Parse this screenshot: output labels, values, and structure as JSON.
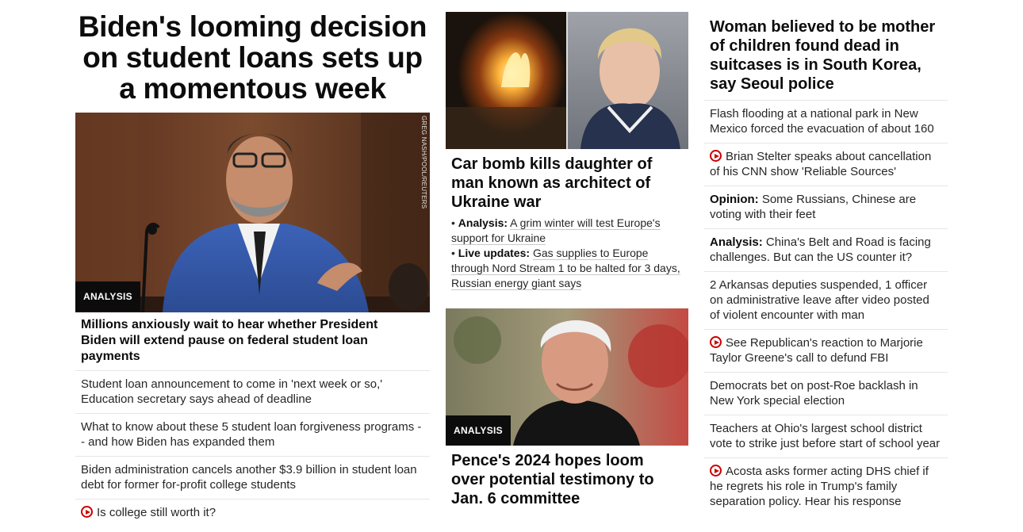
{
  "col1": {
    "headline": "Biden's looming decision on student loans sets up a momentous week",
    "image_badge": "ANALYSIS",
    "image_credit": "GREG NASH/POOL/REUTERS",
    "caption": "Millions anxiously wait to hear whether President Biden will extend pause on federal student loan payments",
    "links": [
      "Student loan announcement to come in 'next week or so,' Education secretary says ahead of deadline",
      "What to know about these 5 student loan forgiveness programs -- and how Biden has expanded them",
      "Biden administration cancels another $3.9 billion in student loan debt for former for-profit college students",
      "Is college still worth it?"
    ]
  },
  "col2": {
    "story1": {
      "headline": "Car bomb kills daughter of man known as architect of Ukraine war",
      "bullet1_label": "Analysis:",
      "bullet1_text": "A grim winter will test Europe's support for Ukraine",
      "bullet2_label": "Live updates:",
      "bullet2_text": "Gas supplies to Europe through Nord Stream 1 to be halted for 3 days, Russian energy giant says"
    },
    "story2": {
      "image_badge": "ANALYSIS",
      "headline": "Pence's 2024 hopes loom over potential testimony to Jan. 6 committee"
    }
  },
  "col3": {
    "lead": "Woman believed to be mother of children found dead in suitcases is in South Korea, say Seoul police",
    "items": [
      {
        "prefix": "",
        "text": "Flash flooding at a national park in New Mexico forced the evacuation of about 160",
        "video": false
      },
      {
        "prefix": "",
        "text": "Brian Stelter speaks about cancellation of his CNN show 'Reliable Sources'",
        "video": true
      },
      {
        "prefix": "Opinion:",
        "text": " Some Russians, Chinese are voting with their feet",
        "video": false
      },
      {
        "prefix": "Analysis:",
        "text": " China's Belt and Road is facing challenges. But can the US counter it?",
        "video": false
      },
      {
        "prefix": "",
        "text": "2 Arkansas deputies suspended, 1 officer on administrative leave after video posted of violent encounter with man",
        "video": false
      },
      {
        "prefix": "",
        "text": "See Republican's reaction to Marjorie Taylor Greene's call to defund FBI",
        "video": true
      },
      {
        "prefix": "",
        "text": "Democrats bet on post-Roe backlash in New York special election",
        "video": false
      },
      {
        "prefix": "",
        "text": "Teachers at Ohio's largest school district vote to strike just before start of school year",
        "video": false
      },
      {
        "prefix": "",
        "text": "Acosta asks former acting DHS chief if he regrets his role in Trump's family separation policy. Hear his response",
        "video": true
      }
    ]
  },
  "colors": {
    "video_red": "#cc0000",
    "badge_bg": "#0c0c0c",
    "divider": "#e6e6e6"
  },
  "icons": {
    "video": "play-circle-icon"
  }
}
